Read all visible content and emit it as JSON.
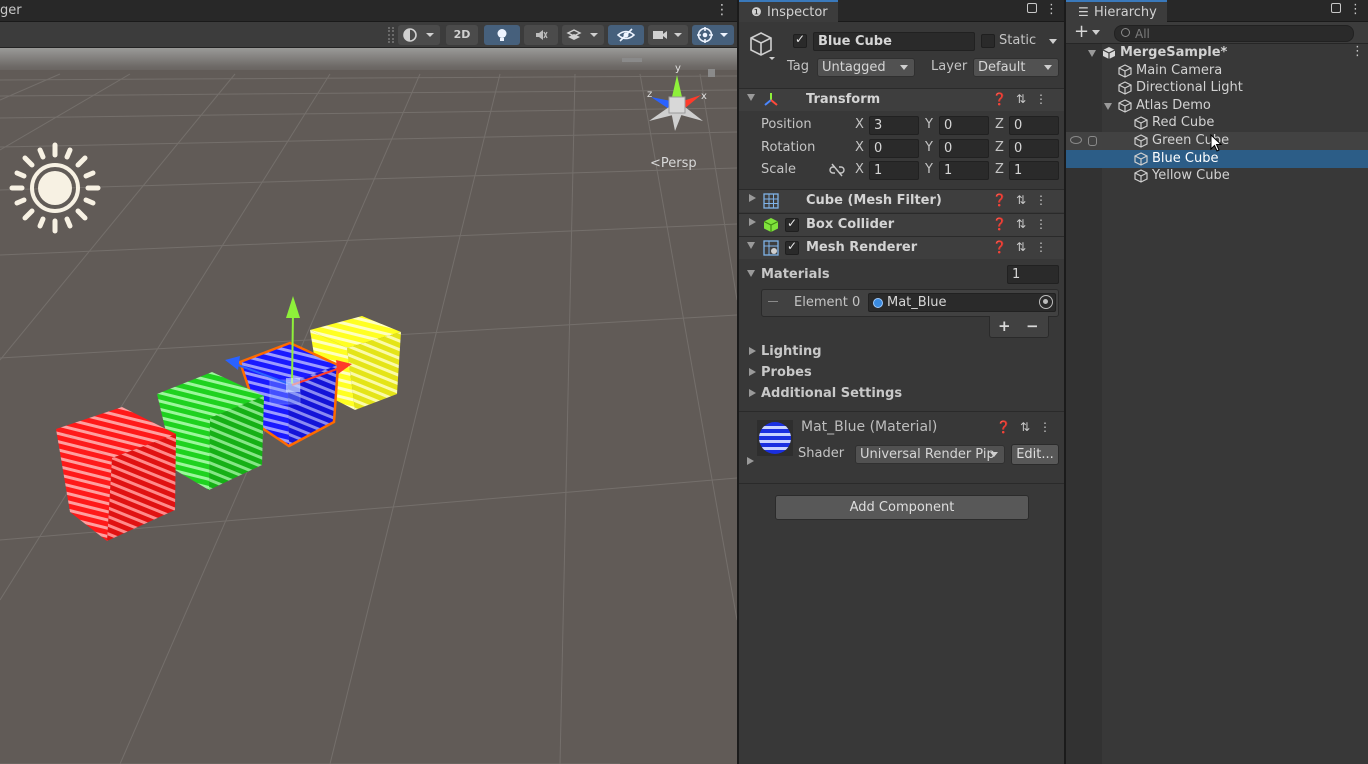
{
  "scene": {
    "tab_title": "ger",
    "menu_icon": "kebab-menu-icon",
    "toolbar": {
      "btn_2d": "2D"
    },
    "persp_label": "<Persp",
    "gizmo_axes": {
      "y": "y",
      "x": "x",
      "z": "z"
    }
  },
  "inspector": {
    "tab_label": "Inspector",
    "object": {
      "name": "Blue Cube",
      "static_label": "Static",
      "tag_label": "Tag",
      "tag_value": "Untagged",
      "layer_label": "Layer",
      "layer_value": "Default"
    },
    "transform": {
      "title": "Transform",
      "position_label": "Position",
      "rotation_label": "Rotation",
      "scale_label": "Scale",
      "axis_x": "X",
      "axis_y": "Y",
      "axis_z": "Z",
      "position": {
        "x": "3",
        "y": "0",
        "z": "0"
      },
      "rotation": {
        "x": "0",
        "y": "0",
        "z": "0"
      },
      "scale": {
        "x": "1",
        "y": "1",
        "z": "1"
      }
    },
    "mesh_filter": {
      "title": "Cube (Mesh Filter)"
    },
    "box_collider": {
      "title": "Box Collider"
    },
    "mesh_renderer": {
      "title": "Mesh Renderer",
      "materials_label": "Materials",
      "materials_count": "1",
      "element0_label": "Element 0",
      "element0_value": "Mat_Blue",
      "add_label": "+",
      "remove_label": "−",
      "lighting_label": "Lighting",
      "probes_label": "Probes",
      "additional_label": "Additional Settings"
    },
    "material": {
      "title": "Mat_Blue (Material)",
      "shader_label": "Shader",
      "shader_value": "Universal Render Pip",
      "edit_label": "Edit..."
    },
    "add_component_label": "Add Component"
  },
  "hierarchy": {
    "tab_label": "Hierarchy",
    "search_placeholder": "All",
    "add_label": "+",
    "items": [
      {
        "label": "MergeSample*",
        "depth": 0
      },
      {
        "label": "Main Camera",
        "depth": 1
      },
      {
        "label": "Directional Light",
        "depth": 1
      },
      {
        "label": "Atlas Demo",
        "depth": 1
      },
      {
        "label": "Red Cube",
        "depth": 2
      },
      {
        "label": "Green Cube",
        "depth": 2
      },
      {
        "label": "Blue Cube",
        "depth": 2
      },
      {
        "label": "Yellow Cube",
        "depth": 2
      }
    ]
  },
  "colors": {
    "selection": "#2c5d87",
    "accent": "#3a79bb",
    "cube_red": "#ff1a1a",
    "cube_green": "#22e022",
    "cube_blue": "#1a1aff",
    "cube_yellow": "#ffff22"
  }
}
